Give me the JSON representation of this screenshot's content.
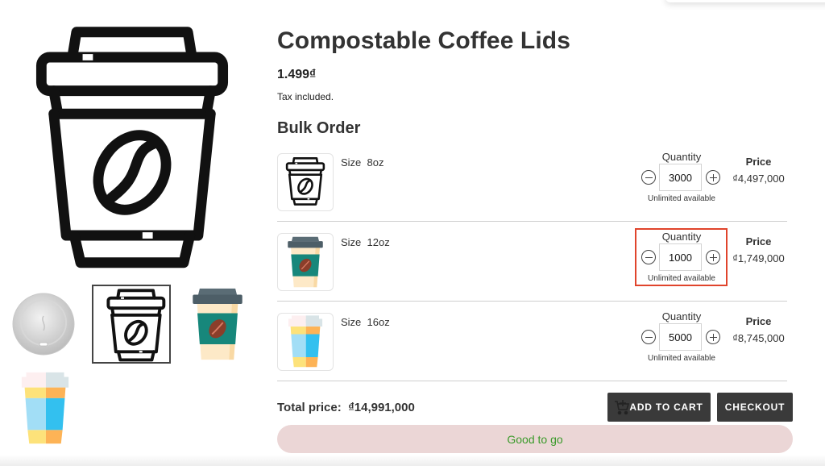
{
  "product": {
    "title": "Compostable Coffee Lids",
    "price": "1.499₫",
    "tax_note": "Tax included."
  },
  "gallery": {
    "main_image": "coffee-cup-outline",
    "thumbnails": [
      {
        "name": "compostable-lid-photo"
      },
      {
        "name": "coffee-cup-outline",
        "selected": true
      },
      {
        "name": "coffee-cup-teal"
      },
      {
        "name": "coffee-cup-blue-yellow"
      }
    ]
  },
  "bulk_order": {
    "title": "Bulk Order",
    "quantity_label": "Quantity",
    "price_label": "Price",
    "rows": [
      {
        "size_label": "Size  8oz",
        "image": "coffee-cup-outline",
        "quantity": "3000",
        "availability": "Unlimited available",
        "price": "₫4,497,000"
      },
      {
        "size_label": "Size  12oz",
        "image": "coffee-cup-teal",
        "quantity": "1000",
        "availability": "Unlimited available",
        "price": "₫1,749,000",
        "highlighted": true
      },
      {
        "size_label": "Size  16oz",
        "image": "coffee-cup-blue-yellow",
        "quantity": "5000",
        "availability": "Unlimited available",
        "price": "₫8,745,000"
      }
    ]
  },
  "footer": {
    "total_label": "Total price:  ₫14,991,000",
    "add_to_cart_label": "ADD TO CART",
    "checkout_label": "CHECKOUT",
    "status_message": "Good to go"
  },
  "colors": {
    "button_bg": "#3a3a3a",
    "status_bg": "#ebd6d6",
    "status_text": "#3a9a2a",
    "highlight_border": "#e0442c"
  }
}
